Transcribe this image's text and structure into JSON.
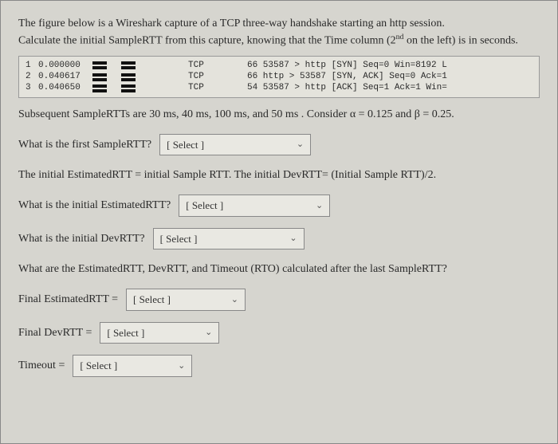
{
  "intro": {
    "line1": "The figure below is a Wireshark capture of a TCP three-way handshake starting an http session.",
    "line2_a": "Calculate the initial SampleRTT from this capture, knowing that the Time column (2",
    "line2_sup": "nd",
    "line2_b": " on the left) is in seconds."
  },
  "capture": [
    {
      "num": "1",
      "time": "0.000000",
      "proto": "TCP",
      "info": "66 53587 > http [SYN] Seq=0 Win=8192 L"
    },
    {
      "num": "2",
      "time": "0.040617",
      "proto": "TCP",
      "info": "66 http > 53587 [SYN, ACK] Seq=0 Ack=1"
    },
    {
      "num": "3",
      "time": "0.040650",
      "proto": "TCP",
      "info": "54 53587 > http [ACK] Seq=1 Ack=1 Win="
    }
  ],
  "subsequent": "Subsequent SampleRTTs are 30 ms, 40 ms, 100 ms, and 50 ms .  Consider α = 0.125 and β = 0.25.",
  "q1": "What is the first SampleRTT?",
  "stmt1": "The initial EstimatedRTT = initial Sample RTT.  The initial DevRTT= (Initial Sample RTT)/2.",
  "q2": "What is the initial EstimatedRTT?",
  "q3": "What is the initial DevRTT?",
  "stmt2": "What are the EstimatedRTT, DevRTT, and Timeout (RTO) calculated after the last SampleRTT?",
  "q4": "Final EstimatedRTT =",
  "q5": "Final DevRTT =",
  "q6": "Timeout =",
  "select_placeholder": "[ Select ]"
}
